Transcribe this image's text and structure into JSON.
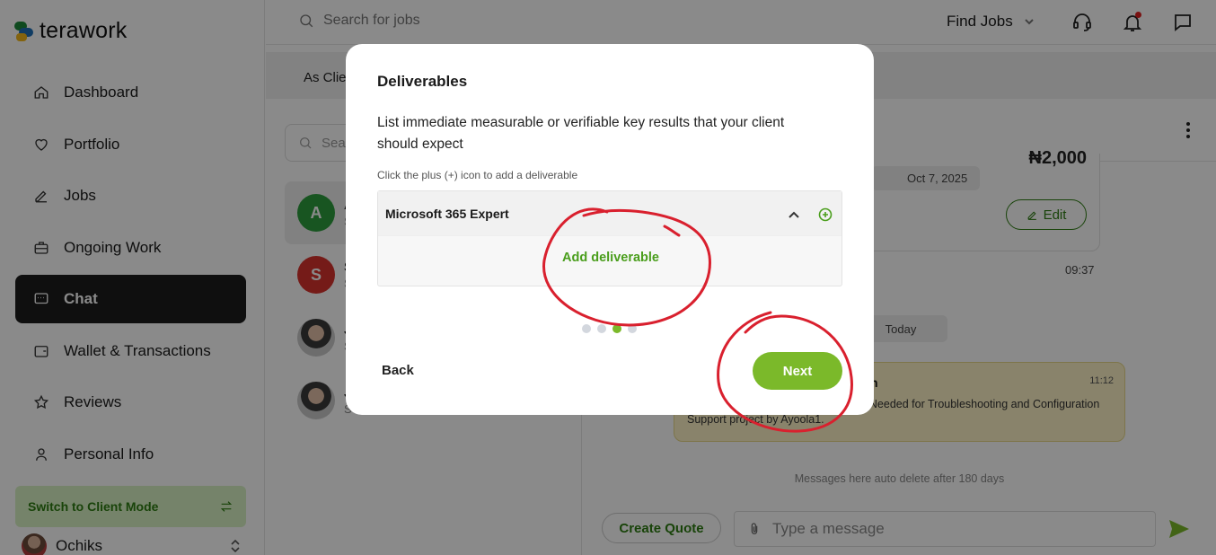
{
  "brand": {
    "name": "terawork"
  },
  "sidebar": {
    "items": [
      {
        "label": "Dashboard",
        "icon": "home-icon"
      },
      {
        "label": "Portfolio",
        "icon": "heart-icon"
      },
      {
        "label": "Jobs",
        "icon": "pencil-icon"
      },
      {
        "label": "Ongoing Work",
        "icon": "briefcase-icon"
      },
      {
        "label": "Chat",
        "icon": "chat-icon",
        "active": true
      },
      {
        "label": "Wallet & Transactions",
        "icon": "wallet-icon"
      },
      {
        "label": "Reviews",
        "icon": "star-icon"
      },
      {
        "label": "Personal Info",
        "icon": "user-icon"
      }
    ],
    "switch_mode": "Switch to Client Mode",
    "user_name": "Ochiks"
  },
  "topbar": {
    "search_placeholder": "Search for jobs",
    "find_jobs": "Find Jobs"
  },
  "chat_list": {
    "tab_client": "As Clie",
    "search_placeholder": "Sea",
    "conversations": [
      {
        "initial": "A",
        "name": "A",
        "sub": "S",
        "color": "#2e9e3e"
      },
      {
        "initial": "S",
        "name": "S",
        "sub": "S",
        "color": "#d9322e"
      },
      {
        "initial": "",
        "name": "J",
        "sub": "S",
        "color": ""
      },
      {
        "initial": "",
        "name": "J",
        "sub": "S",
        "color": ""
      }
    ]
  },
  "chat": {
    "price": "₦2,000",
    "date": "Oct 7, 2025",
    "edit": "Edit",
    "time1": "09:37",
    "today": "Today",
    "sys_title": "n",
    "sys_time": "11:12",
    "sys_body": "ion on job post Microsoft 365 Expert Needed for Troubleshooting and Configuration Support project by Ayoola1.",
    "auto_delete": "Messages here auto delete after 180 days",
    "create_quote": "Create Quote",
    "message_placeholder": "Type a message"
  },
  "modal": {
    "title": "Deliverables",
    "description": "List immediate measurable or verifiable key results that your client should expect",
    "hint": "Click the plus (+) icon to add a deliverable",
    "accordion_title": "Microsoft 365 Expert",
    "add_deliverable": "Add deliverable",
    "steps_total": 4,
    "current_step": 3,
    "back": "Back",
    "next": "Next"
  },
  "colors": {
    "accent_green": "#7bb92a",
    "dark_green": "#2e7d12",
    "annotation_red": "#d9202e"
  }
}
